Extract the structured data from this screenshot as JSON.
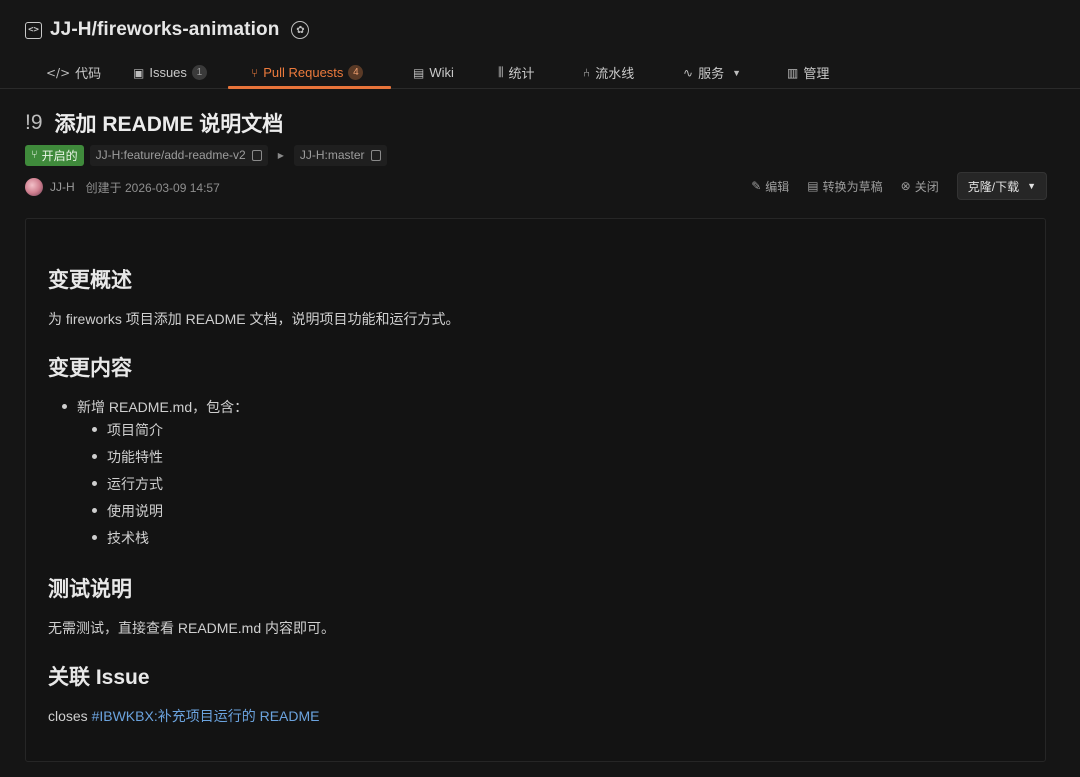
{
  "repo": {
    "name": "JJ-H/fireworks-animation"
  },
  "tabs": [
    {
      "label": "代码",
      "icon": "code-icon"
    },
    {
      "label": "Issues",
      "count": "1",
      "icon": "issues-icon"
    },
    {
      "label": "Pull Requests",
      "count": "4",
      "icon": "pull-request-icon",
      "active": true
    },
    {
      "label": "Wiki",
      "icon": "wiki-icon"
    },
    {
      "label": "统计",
      "icon": "stats-icon"
    },
    {
      "label": "流水线",
      "icon": "pipeline-icon"
    },
    {
      "label": "服务",
      "icon": "service-icon"
    },
    {
      "label": "管理",
      "icon": "manage-icon"
    }
  ],
  "pr": {
    "number": "!9",
    "title": "添加 README 说明文档",
    "status": "开启的",
    "source_branch": "JJ-H:feature/add-readme-v2",
    "target_branch": "JJ-H:master",
    "author": "JJ-H",
    "created": "创建于 2026-03-09 14:57"
  },
  "actions": {
    "edit": "编辑",
    "draft": "转换为草稿",
    "close": "关闭",
    "clone": "克隆/下载"
  },
  "description": {
    "h_summary": "变更概述",
    "summary": "为 fireworks 项目添加 README 文档，说明项目功能和运行方式。",
    "h_changes": "变更内容",
    "change_item": "新增 README.md，包含：",
    "sub_items": [
      "项目简介",
      "功能特性",
      "运行方式",
      "使用说明",
      "技术栈"
    ],
    "h_test": "测试说明",
    "test": "无需测试，直接查看 README.md 内容即可。",
    "h_issue": "关联 Issue",
    "issue_prefix": "closes ",
    "issue_link": "#IBWKBX:补充项目运行的 README"
  },
  "colors": {
    "accent": "#e8743a",
    "open": "#3f8a3b",
    "link": "#6ba3de"
  }
}
